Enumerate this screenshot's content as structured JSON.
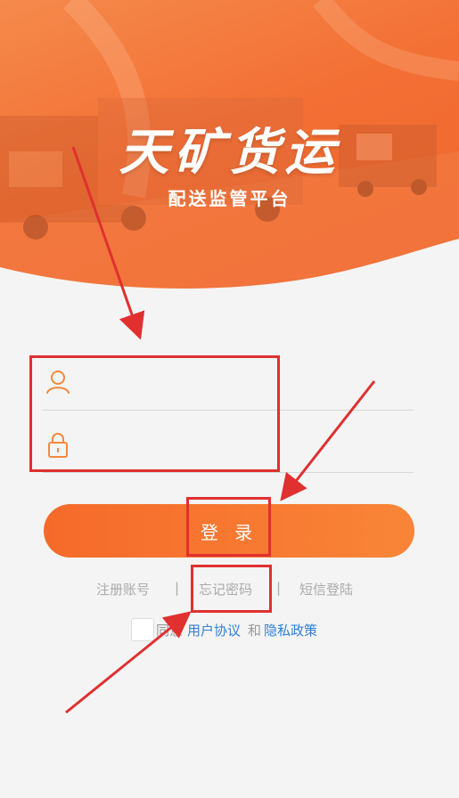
{
  "header": {
    "title": "天矿货运",
    "subtitle": "配送监管平台"
  },
  "form": {
    "username_icon": "user-icon",
    "password_icon": "lock-icon",
    "username_value": "",
    "password_value": ""
  },
  "login_button": {
    "label": "登 录"
  },
  "links": {
    "register": "注册账号",
    "divider": "|",
    "forgot": "忘记密码",
    "sms_login": "短信登陆"
  },
  "agreement": {
    "prefix": "同意",
    "user_agreement": "用户协议",
    "and": "和",
    "privacy_policy": "隐私政策",
    "checked": false
  },
  "colors": {
    "brand_orange": "#f36f34",
    "link_blue": "#2f7fd8",
    "annotation_red": "#e03030"
  }
}
